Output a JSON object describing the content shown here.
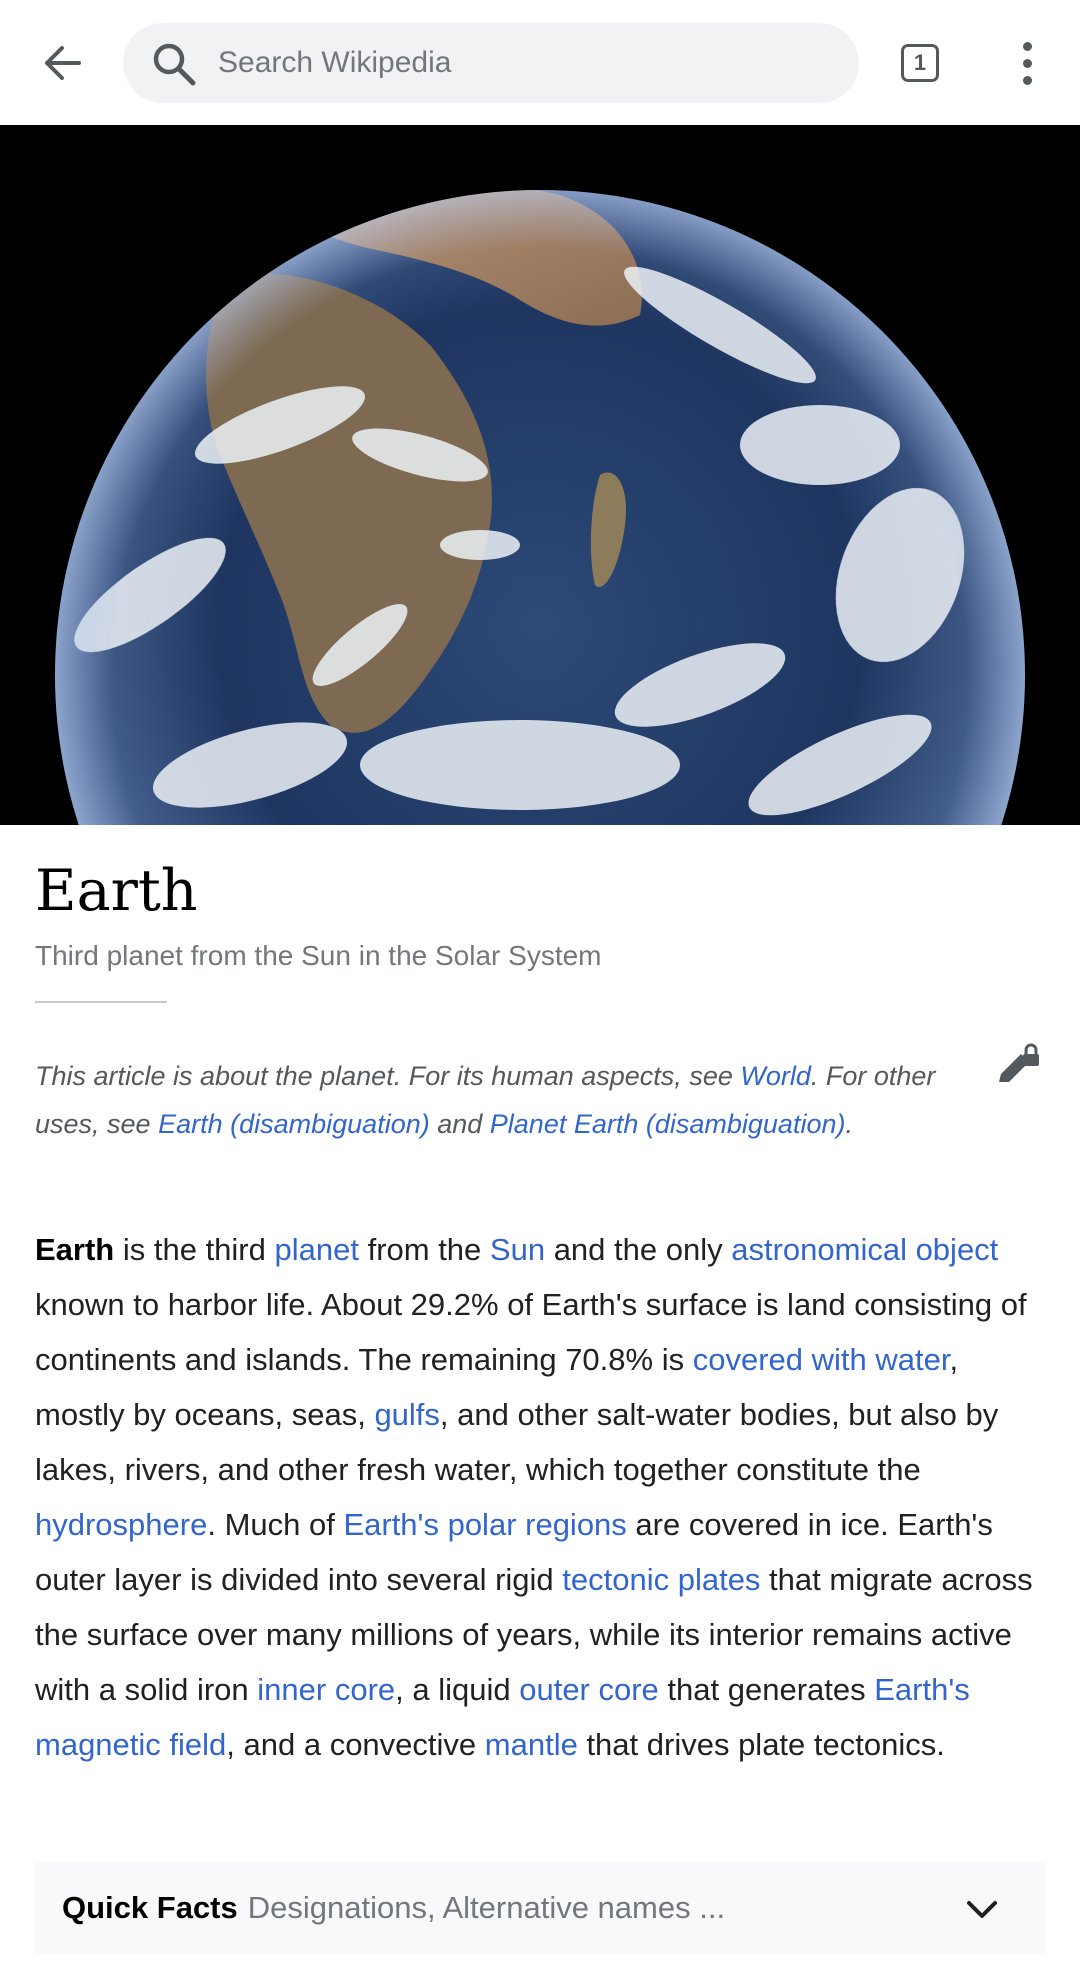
{
  "toolbar": {
    "search_placeholder": "Search Wikipedia",
    "tab_count": "1",
    "back_icon": "arrow-left-icon",
    "more_icon": "more-vertical-icon"
  },
  "hero": {
    "image": "earth-from-space-photo"
  },
  "article": {
    "title": "Earth",
    "description": "Third planet from the Sun in the Solar System",
    "hatnote": {
      "t1": "This article is about the planet. For its human aspects, see ",
      "l1": "World",
      "t2": ". For other uses, see ",
      "l2": "Earth (disambiguation)",
      "t3": " and ",
      "l3": "Planet Earth (disambiguation)",
      "t4": "."
    },
    "intro": {
      "s0": "Earth",
      "s1": " is the third ",
      "l1": "planet",
      "s2": " from the ",
      "l2": "Sun",
      "s3": " and the only ",
      "l3": "astronomical object",
      "s4": " known to harbor life. About 29.2% of Earth's surface is land consisting of continents and islands. The remaining 70.8% is ",
      "l4": "covered with water",
      "s5": ", mostly by oceans, seas, ",
      "l5": "gulfs",
      "s6": ", and other salt-water bodies, but also by lakes, rivers, and other fresh water, which together constitute the ",
      "l6": "hydrosphere",
      "s7": ". Much of ",
      "l7": "Earth's polar regions",
      "s8": " are covered in ice. Earth's outer layer is divided into several rigid ",
      "l8": "tectonic plates",
      "s9": " that migrate across the surface over many millions of years, while its interior remains active with a solid iron ",
      "l9": "inner core",
      "s10": ", a liquid ",
      "l10": "outer core",
      "s11": " that generates ",
      "l11": "Earth's magnetic field",
      "s12": ", and a convective ",
      "l12": "mantle",
      "s13": " that drives plate tectonics."
    }
  },
  "quick_facts": {
    "title": "Quick Facts",
    "subtitle": "Designations, Alternative names ..."
  },
  "colors": {
    "link": "#3366cc",
    "text": "#202122",
    "muted": "#72777d"
  }
}
